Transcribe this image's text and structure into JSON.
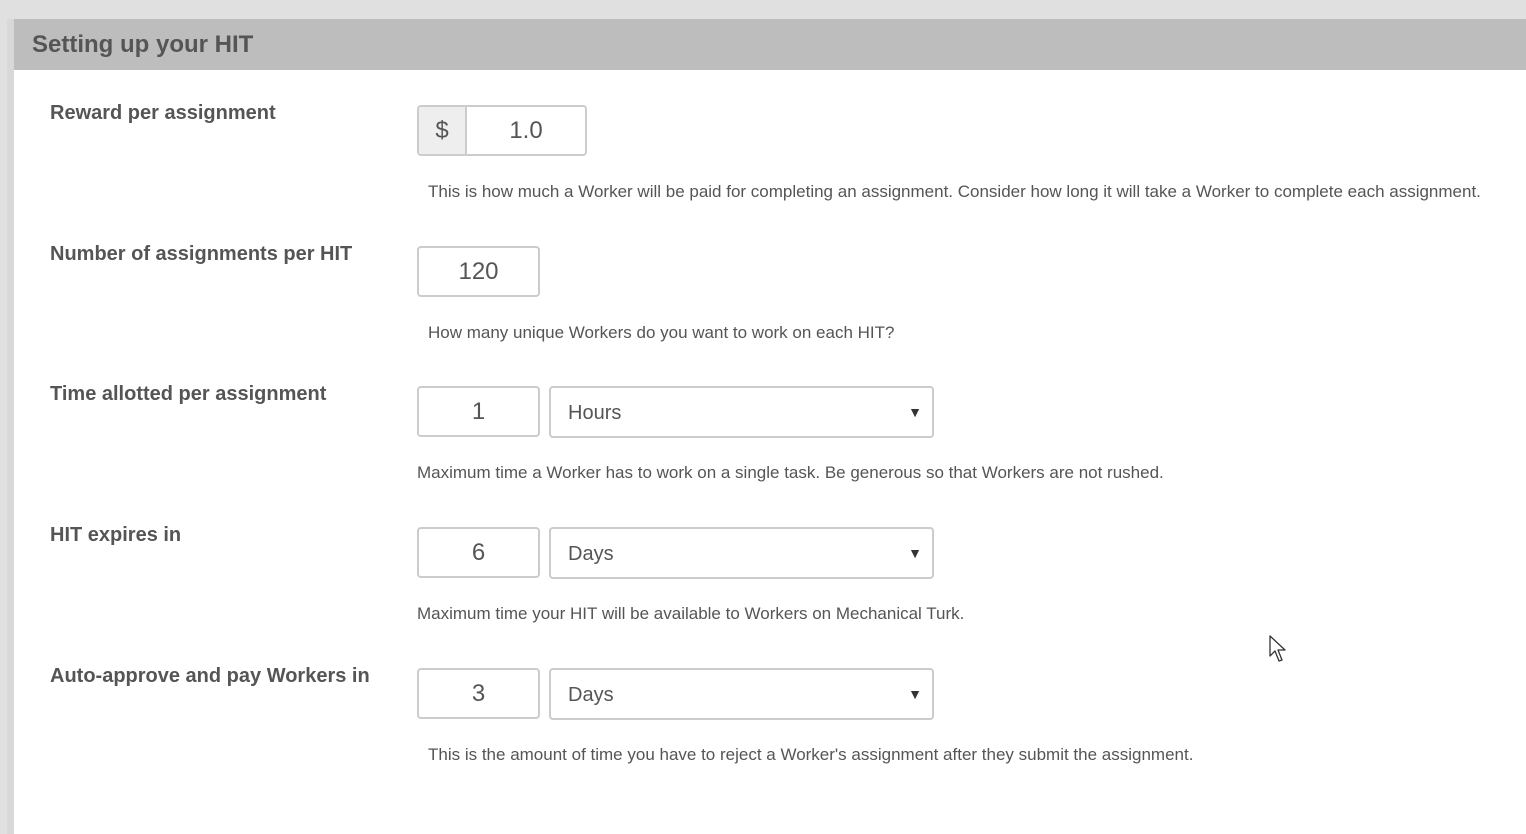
{
  "section": {
    "title": "Setting up your HIT"
  },
  "fields": {
    "reward": {
      "label": "Reward per assignment",
      "currency_symbol": "$",
      "value": "1.0",
      "help": "This is how much a Worker will be paid for completing an assignment. Consider how long it will take a Worker to complete each assignment."
    },
    "assignments": {
      "label": "Number of assignments per HIT",
      "value": "120",
      "help": "How many unique Workers do you want to work on each HIT?"
    },
    "time_allotted": {
      "label": "Time allotted per assignment",
      "value": "1",
      "unit": "Hours",
      "help": "Maximum time a Worker has to work on a single task. Be generous so that Workers are not rushed."
    },
    "expires": {
      "label": "HIT expires in",
      "value": "6",
      "unit": "Days",
      "help": "Maximum time your HIT will be available to Workers on Mechanical Turk."
    },
    "auto_approve": {
      "label": "Auto-approve and pay Workers in",
      "value": "3",
      "unit": "Days",
      "help": "This is the amount of time you have to reject a Worker's assignment after they submit the assignment."
    }
  },
  "icons": {
    "dropdown": "chevron-down-icon",
    "cursor": "mouse-pointer-icon"
  }
}
